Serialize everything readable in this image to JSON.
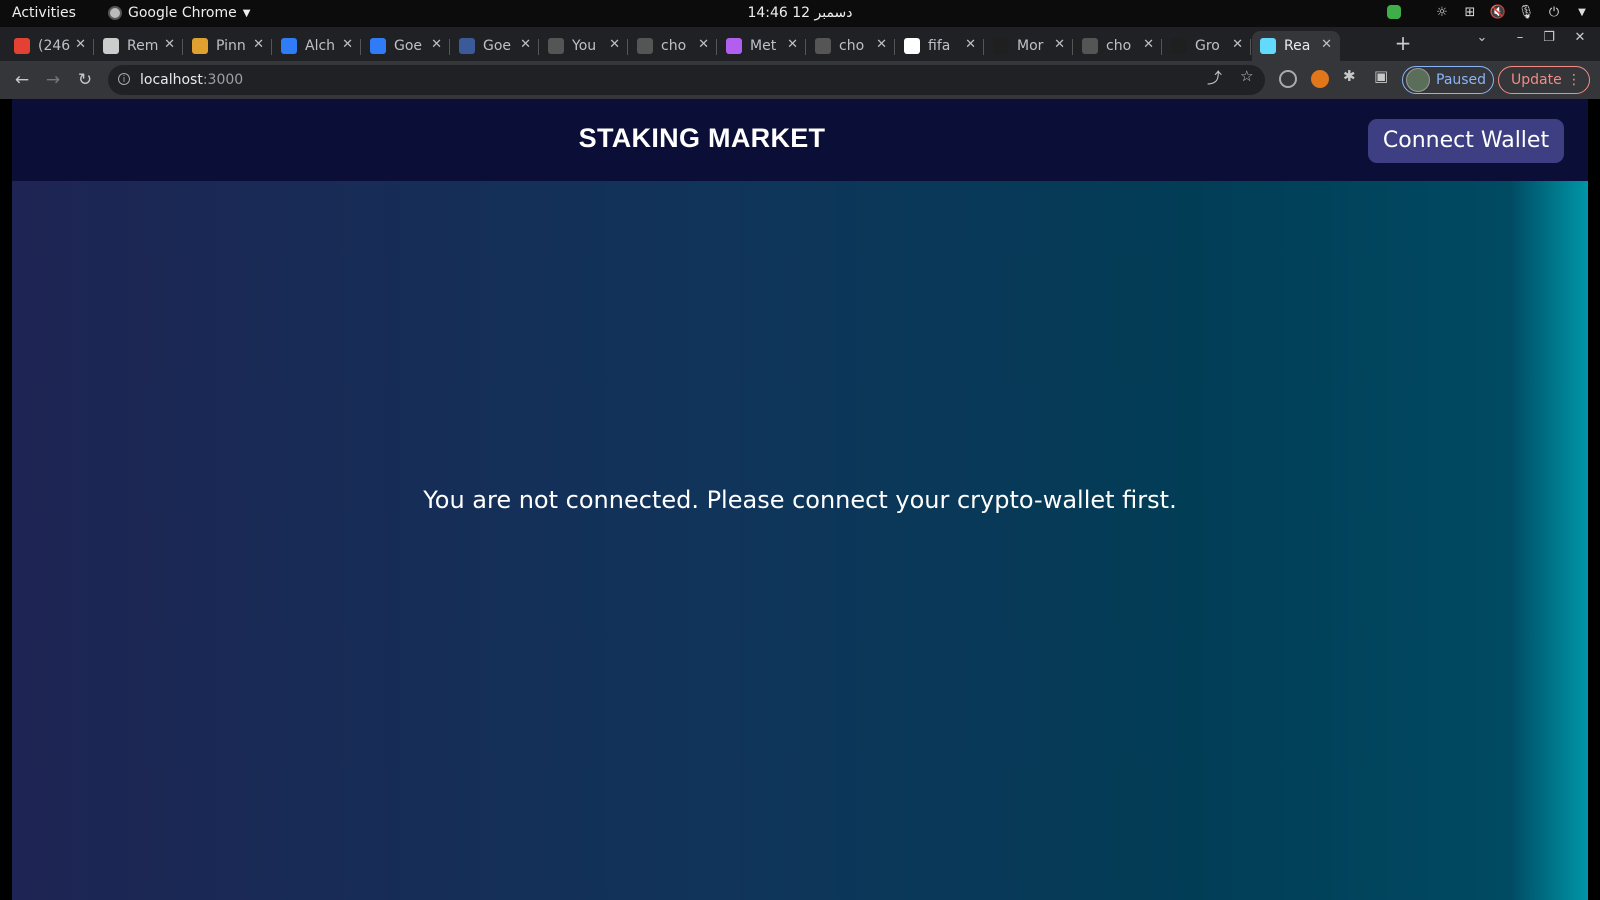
{
  "os_bar": {
    "activities": "Activities",
    "app_name": "Google Chrome",
    "clock": "14:46  12 دسمبر"
  },
  "tabs": [
    {
      "label": "(246",
      "favicon_color": "#e34133"
    },
    {
      "label": "Rem",
      "favicon_color": "#cccccc"
    },
    {
      "label": "Pinn",
      "favicon_color": "#e0a030"
    },
    {
      "label": "Alch",
      "favicon_color": "#2f7cf6"
    },
    {
      "label": "Goe",
      "favicon_color": "#2f7cf6"
    },
    {
      "label": "Goe",
      "favicon_color": "#3b5a9a"
    },
    {
      "label": "You",
      "favicon_color": "#555555"
    },
    {
      "label": "cho",
      "favicon_color": "#555555"
    },
    {
      "label": "Met",
      "favicon_color": "#b25ff0"
    },
    {
      "label": "cho",
      "favicon_color": "#555555"
    },
    {
      "label": "fifa",
      "favicon_color": "#ffffff"
    },
    {
      "label": "Mor",
      "favicon_color": "#1f1f1f"
    },
    {
      "label": "cho",
      "favicon_color": "#555555"
    },
    {
      "label": "Gro",
      "favicon_color": "#1f1f1f"
    },
    {
      "label": "Rea",
      "favicon_color": "#61dafb",
      "active": true
    }
  ],
  "address_bar": {
    "host": "localhost",
    "port": ":3000"
  },
  "profile": {
    "label": "Paused"
  },
  "update_button": {
    "label": "Update"
  },
  "app": {
    "brand": "STAKING MARKET",
    "connect_button": "Connect Wallet",
    "notice": "You are not connected. Please connect your crypto-wallet first."
  }
}
